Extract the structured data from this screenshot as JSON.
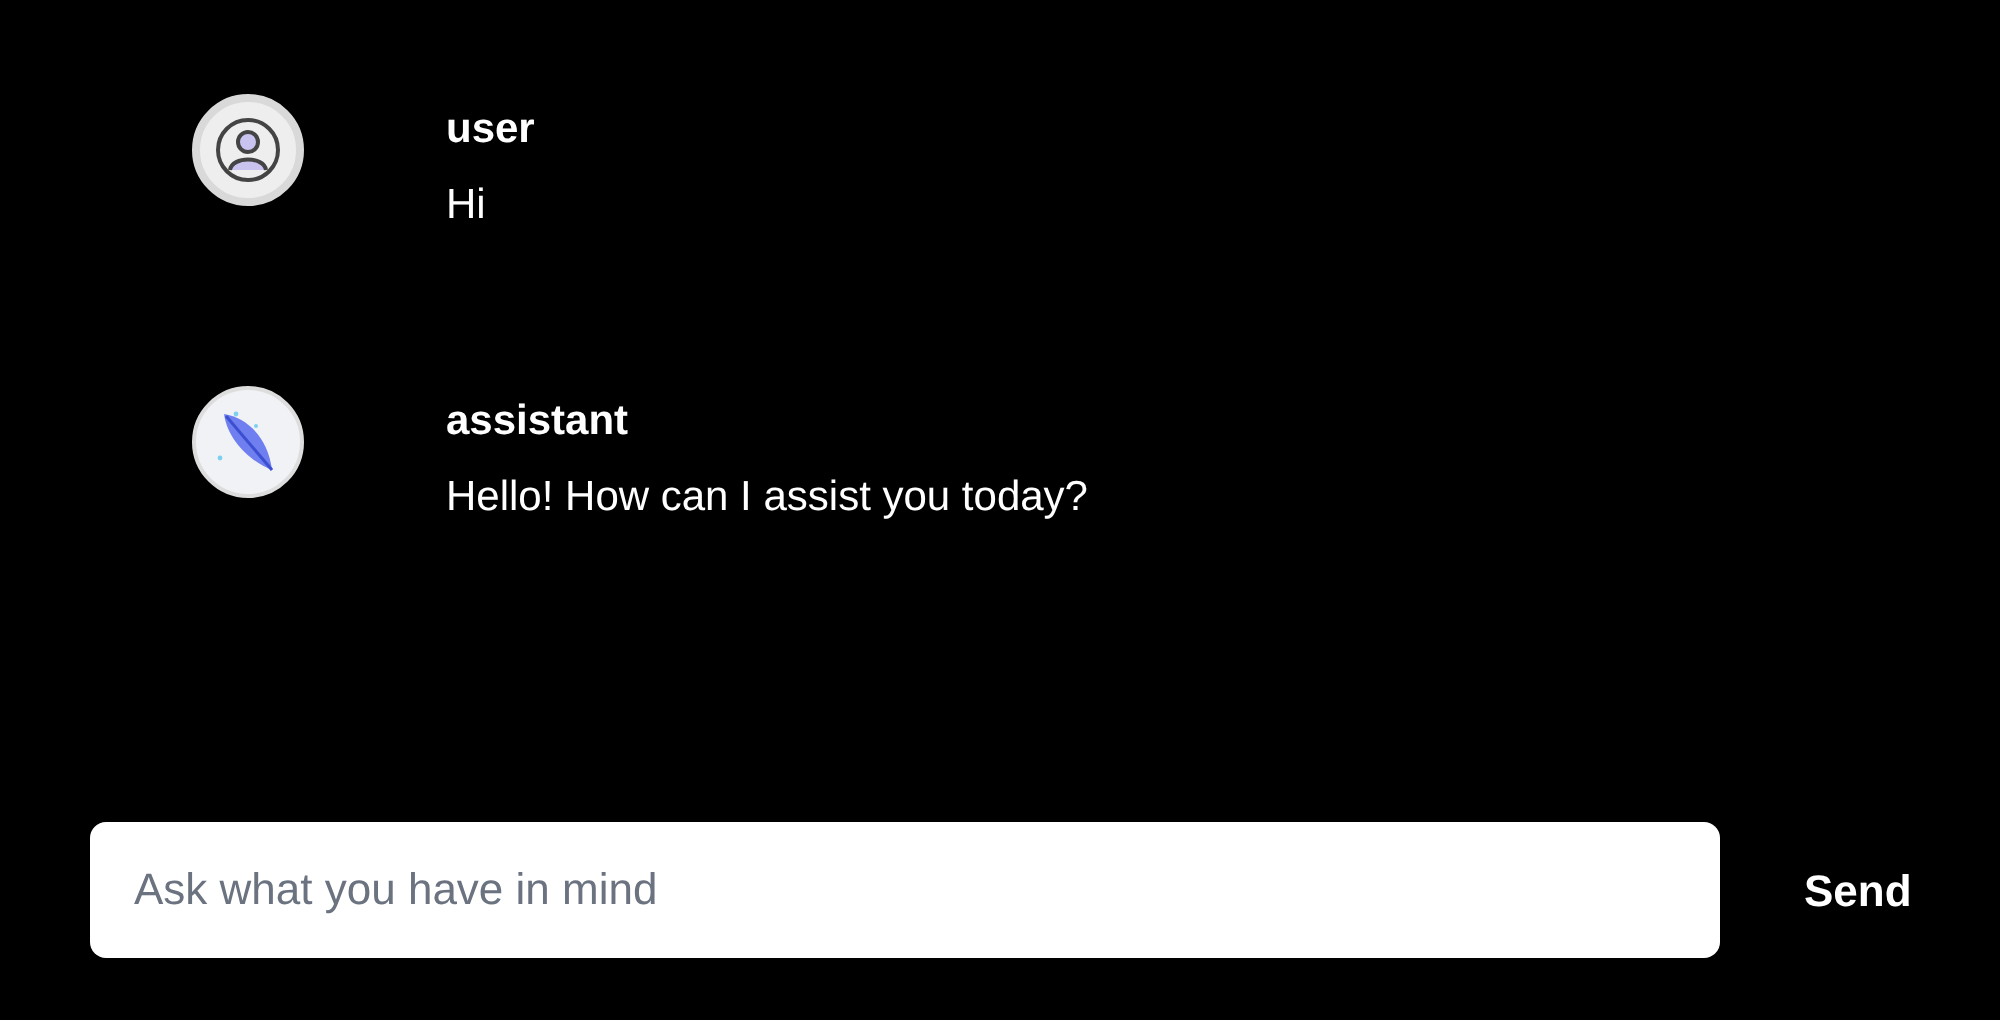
{
  "messages": [
    {
      "kind": "user",
      "author": "user",
      "text": "Hi"
    },
    {
      "kind": "assistant",
      "author": "assistant",
      "text": "Hello! How can I assist you today?"
    }
  ],
  "composer": {
    "placeholder": "Ask what you have in mind",
    "send_label": "Send"
  }
}
